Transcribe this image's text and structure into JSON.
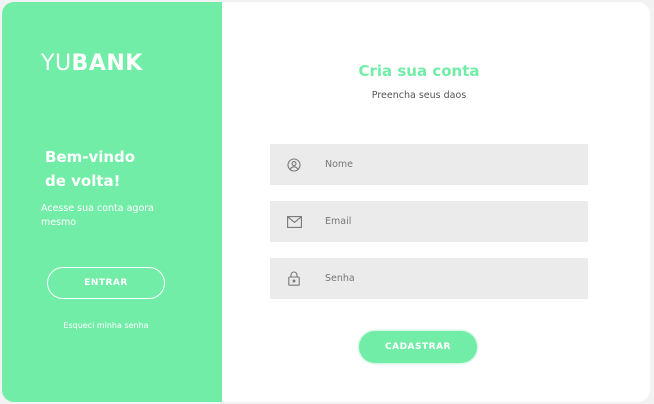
{
  "brand": {
    "logo_light": "YU",
    "logo_bold": "BANK"
  },
  "welcome_panel": {
    "title_line1": "Bem-vindo",
    "title_line2": "de volta!",
    "subtitle": "Acesse sua conta agora mesmo",
    "enter_button": "ENTRAR",
    "forgot_link": "Esqueci minha senha",
    "background_color": "#72eda8"
  },
  "signup_form": {
    "title": "Cria sua conta",
    "subtitle": "Preencha seus daos",
    "fields": [
      {
        "icon": "user-icon",
        "placeholder": "Nome",
        "value": ""
      },
      {
        "icon": "mail-icon",
        "placeholder": "Email",
        "value": ""
      },
      {
        "icon": "lock-icon",
        "placeholder": "Senha",
        "value": ""
      }
    ],
    "register_button": "CADASTRAR",
    "accent_color": "#72eda8"
  }
}
